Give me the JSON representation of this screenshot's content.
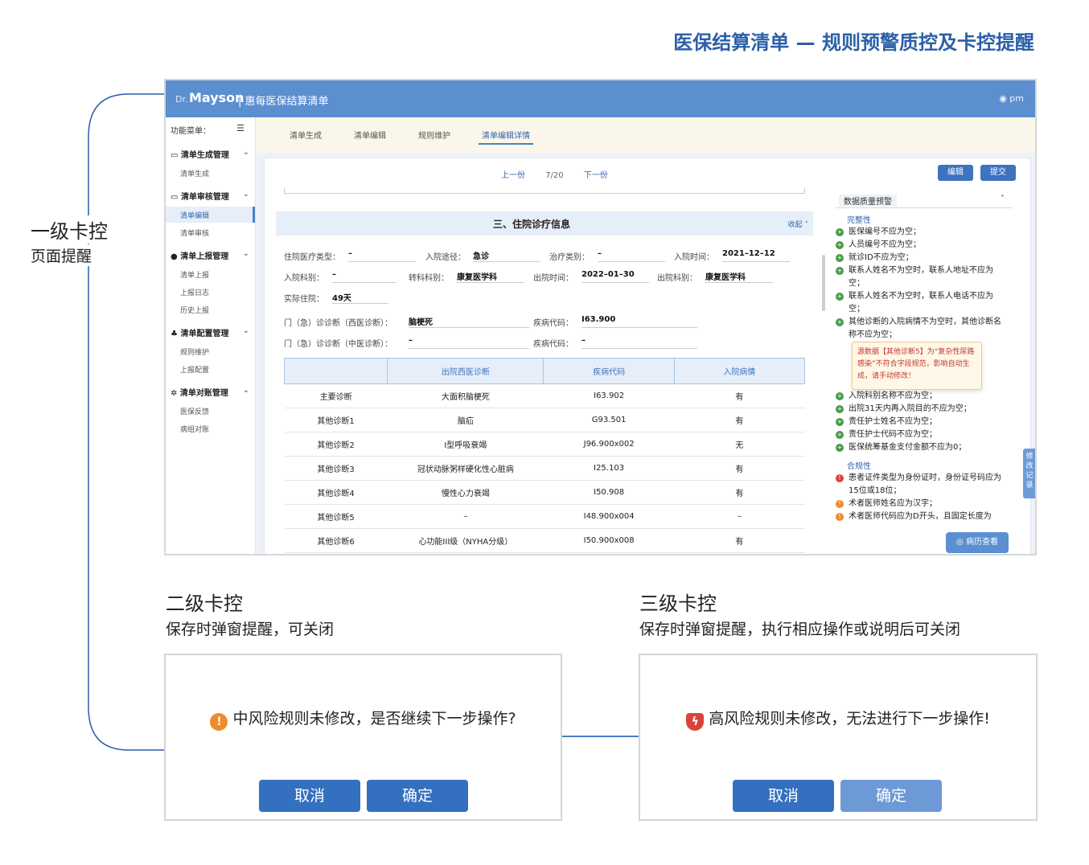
{
  "headline": "医保结算清单 — 规则预警质控及卡控提醒",
  "level1": {
    "title": "一级卡控",
    "desc": "页面提醒"
  },
  "app": {
    "logo_small": "Dr.",
    "logo_big": "Mayson",
    "title": "| 惠每医保结算清单",
    "user": "pm",
    "menu_head": "功能菜单：",
    "sidebar": [
      {
        "label": "清单生成管理",
        "items": [
          "清单生成"
        ]
      },
      {
        "label": "清单审核管理",
        "items": [
          "清单编辑",
          "清单审核"
        ],
        "active": "清单编辑"
      },
      {
        "label": "清单上报管理",
        "items": [
          "清单上报",
          "上报日志",
          "历史上报"
        ]
      },
      {
        "label": "清单配置管理",
        "items": [
          "规则维护",
          "上报配置"
        ]
      },
      {
        "label": "清单对账管理",
        "items": [
          "医保反馈",
          "病组对账"
        ]
      }
    ],
    "tabs": [
      "清单生成",
      "清单编辑",
      "规则维护",
      "清单编辑详情"
    ],
    "active_tab": "清单编辑详情",
    "pager": {
      "prev": "上一份",
      "count": "7/20",
      "next": "下一份"
    },
    "edit_btn": "编辑",
    "submit_btn": "提交",
    "section_title": "三、住院诊疗信息",
    "collapse": "收起",
    "fields": {
      "ins_type_label": "住院医疗类型：",
      "ins_type": "–",
      "admit_route_label": "入院途径：",
      "admit_route": "急诊",
      "treat_type_label": "治疗类别：",
      "treat_type": "–",
      "admit_time_label": "入院时间：",
      "admit_time": "2021–12–12",
      "admit_dept_label": "入院科别：",
      "admit_dept": "–",
      "transfer_dept_label": "转科科别：",
      "transfer_dept": "康复医学科",
      "discharge_time_label": "出院时间：",
      "discharge_time": "2022–01–30",
      "discharge_dept_label": "出院科别：",
      "discharge_dept": "康复医学科",
      "actual_stay_label": "实际住院：",
      "actual_stay": "49天",
      "er_west_label": "门（急）诊诊断（西医诊断）：",
      "er_west": "脑梗死",
      "er_west_code_label": "疾病代码：",
      "er_west_code": "I63.900",
      "er_tcm_label": "门（急）诊诊断（中医诊断）：",
      "er_tcm": "–",
      "er_tcm_code_label": "疾病代码：",
      "er_tcm_code": "–"
    },
    "table": {
      "headers": [
        "",
        "出院西医诊断",
        "疾病代码",
        "入院病情"
      ],
      "rows": [
        [
          "主要诊断",
          "大面积脑梗死",
          "I63.902",
          "有"
        ],
        [
          "其他诊断1",
          "脑疝",
          "G93.501",
          "有"
        ],
        [
          "其他诊断2",
          "I型呼吸衰竭",
          "J96.900x002",
          "无"
        ],
        [
          "其他诊断3",
          "冠状动脉粥样硬化性心脏病",
          "I25.103",
          "有"
        ],
        [
          "其他诊断4",
          "慢性心力衰竭",
          "I50.908",
          "有"
        ],
        [
          "其他诊断5",
          "–",
          "I48.900x004",
          "–"
        ],
        [
          "其他诊断6",
          "心功能III级（NYHA分级）",
          "I50.900x008",
          "有"
        ]
      ]
    },
    "quality": {
      "title": "数据质量预警",
      "cat_complete": "完整性",
      "complete_items": [
        "医保编号不应为空；",
        "人员编号不应为空；",
        "就诊ID不应为空；",
        "联系人姓名不为空时，联系人地址不应为空；",
        "联系人姓名不为空时，联系人电话不应为空；",
        "其他诊断的入院病情不为空时，其他诊断名称不应为空；",
        "入院科别名称不应为空；",
        "出院31天内再入院目的不应为空；",
        "责任护士姓名不应为空；",
        "责任护士代码不应为空；",
        "医保统筹基金支付金额不应为0；"
      ],
      "cat_compliance": "合规性",
      "compliance_items": [
        "患者证件类型为身份证时，身份证号码应为15位或18位；",
        "术者医师姓名应为汉字；",
        "术者医师代码应为D开头，且固定长度为"
      ],
      "tooltip": "源数据【其他诊断5】为“复杂性尿路感染”不符合字段规范，影响自动生成，请手动修改！"
    },
    "edit_record": "修改记录",
    "case_btn": "病历查看"
  },
  "level2": {
    "title": "二级卡控",
    "desc": "保存时弹窗提醒，可关闭",
    "message": "中风险规则未修改，是否继续下一步操作?",
    "cancel": "取消",
    "confirm": "确定"
  },
  "level3": {
    "title": "三级卡控",
    "desc": "保存时弹窗提醒，执行相应操作或说明后可关闭",
    "message": "高风险规则未修改，无法进行下一步操作!",
    "cancel": "取消",
    "confirm": "确定"
  },
  "colors": {
    "accent": "#2b5fa8",
    "topbar": "#5b8fd0",
    "button": "#3470c0",
    "warn": "#ef8b2c",
    "danger": "#d9433b"
  }
}
